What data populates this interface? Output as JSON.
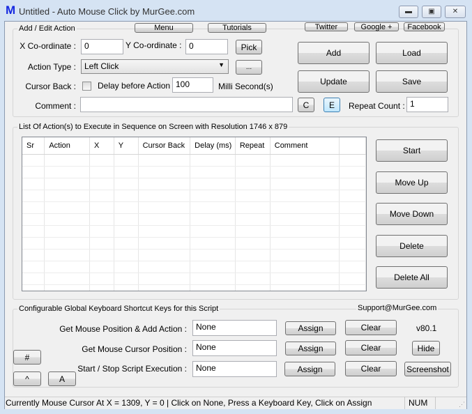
{
  "window": {
    "title": "Untitled - Auto Mouse Click by MurGee.com",
    "logo": "M"
  },
  "top_buttons": {
    "menu": "Menu",
    "tutorials": "Tutorials",
    "twitter": "Twitter",
    "google": "Google +",
    "facebook": "Facebook"
  },
  "edit": {
    "group_label": "Add / Edit Action",
    "x_label": "X Co-ordinate :",
    "x_value": "0",
    "y_label": "Y Co-ordinate :",
    "y_value": "0",
    "pick": "Pick",
    "action_type_label": "Action Type :",
    "action_type_value": "Left Click",
    "more": "...",
    "cursor_back_label": "Cursor Back :",
    "delay_label": "Delay before Action :",
    "delay_value": "100",
    "delay_unit": "Milli Second(s)",
    "comment_label": "Comment :",
    "comment_value": "",
    "c": "C",
    "e": "E",
    "repeat_label": "Repeat Count :",
    "repeat_value": "1",
    "add": "Add",
    "load": "Load",
    "update": "Update",
    "save": "Save"
  },
  "list": {
    "group_label": "List Of Action(s) to Execute in Sequence on Screen with Resolution 1746 x 879",
    "columns": [
      "Sr",
      "Action",
      "X",
      "Y",
      "Cursor Back",
      "Delay (ms)",
      "Repeat",
      "Comment"
    ],
    "start": "Start",
    "move_up": "Move Up",
    "move_down": "Move Down",
    "delete": "Delete",
    "delete_all": "Delete All"
  },
  "shortcuts": {
    "group_label": "Configurable Global Keyboard Shortcut Keys for this Script",
    "support": "Support@MurGee.com",
    "rows": [
      {
        "label": "Get Mouse Position & Add Action :",
        "value": "None",
        "assign": "Assign",
        "clear": "Clear"
      },
      {
        "label": "Get Mouse Cursor Position :",
        "value": "None",
        "assign": "Assign",
        "clear": "Clear"
      },
      {
        "label": "Start / Stop Script Execution :",
        "value": "None",
        "assign": "Assign",
        "clear": "Clear"
      }
    ],
    "version": "v80.1",
    "hide": "Hide",
    "screenshot": "Screenshot",
    "hash": "#",
    "caret": "^",
    "a": "A"
  },
  "status": {
    "text": "Currently Mouse Cursor At X = 1309, Y = 0 | Click on None, Press a Keyboard Key, Click on Assign",
    "num": "NUM"
  }
}
